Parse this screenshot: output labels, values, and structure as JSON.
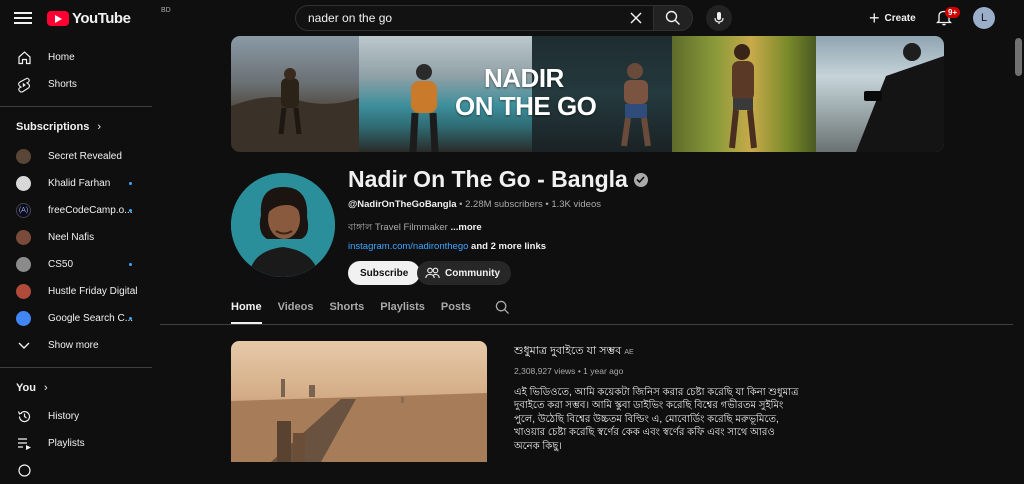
{
  "header": {
    "logo_text": "YouTube",
    "country_code": "BD",
    "search_value": "nader on the go",
    "create_label": "Create",
    "notification_count": "9+",
    "avatar_letter": "L"
  },
  "sidebar": {
    "main": [
      {
        "label": "Home",
        "icon": "home-icon"
      },
      {
        "label": "Shorts",
        "icon": "shorts-icon"
      }
    ],
    "subscriptions_heading": "Subscriptions",
    "subscriptions": [
      {
        "label": "Secret Revealed",
        "color": "#5a4636",
        "dot": false
      },
      {
        "label": "Khalid Farhan",
        "color": "#d8d8d8",
        "dot": true
      },
      {
        "label": "freeCodeCamp.o...",
        "color": "#0a0a23",
        "dot": true
      },
      {
        "label": "Neel Nafis",
        "color": "#7a4b3a",
        "dot": false
      },
      {
        "label": "CS50",
        "color": "#8b8b8b",
        "dot": true
      },
      {
        "label": "Hustle Friday Digital",
        "color": "#b04a3a",
        "dot": false
      },
      {
        "label": "Google Search C...",
        "color": "#4285f4",
        "dot": true
      }
    ],
    "show_more_label": "Show more",
    "you_heading": "You",
    "you_items": [
      {
        "label": "History",
        "icon": "history-icon"
      },
      {
        "label": "Playlists",
        "icon": "playlists-icon"
      }
    ]
  },
  "banner": {
    "title_line1": "NADIR",
    "title_line2": "ON THE GO"
  },
  "channel": {
    "name": "Nadir On The Go - Bangla",
    "handle": "@NadirOnTheGoBangla",
    "subscribers": "2.28M subscribers",
    "videos": "1.3K videos",
    "separator": "•",
    "description": "বাঙ্গাল Travel Filmmaker",
    "more_label": "...more",
    "link": "instagram.com/nadironthego",
    "more_links": "and 2 more links",
    "subscribe_label": "Subscribe",
    "community_label": "Community"
  },
  "tabs": [
    "Home",
    "Videos",
    "Shorts",
    "Playlists",
    "Posts"
  ],
  "active_tab": "Home",
  "featured_video": {
    "title": "শুধুমাত্র দুবাইতে যা সম্ভব",
    "title_suffix": "AE",
    "views": "2,308,927 views",
    "age": "1 year ago",
    "description": "এই ভিডিওতে, আমি কয়েকটা জিনিস করার চেষ্টা করেছি যা কিনা শুধুমাত্র দুবাইতে করা সম্ভব। আমি স্কুবা ডাইভিং করেছি বিশ্বের গভীরতম সুইমিং পুলে, উঠেছি বিশ্বের উচ্চতম বিল্ডিং এ, মোবোর্ডিং করেছি মরুভূমিতে, খাওয়ার চেষ্টা করেছি স্বর্ণের কেক এবং স্বর্ণের কফি এবং সাথে আরও অনেক কিছু।"
  }
}
